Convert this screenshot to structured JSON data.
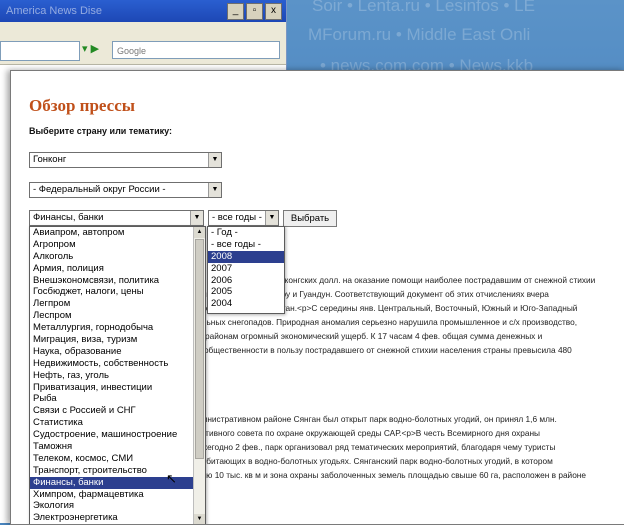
{
  "background": {
    "lines": [
      "Soir • Lenta.ru • Lesinfos • LE",
      "MForum.ru • Middle East Onli",
      "• news.com.com • News.kkb"
    ],
    "back_title": "America News Dise"
  },
  "back_window": {
    "controls": [
      "_",
      "▫",
      "x"
    ],
    "search_placeholder": "Google"
  },
  "page": {
    "title": "Обзор прессы",
    "prompt": "Выберите страну или тематику:",
    "country_select": "Гонконг",
    "district_select": "- Федеральный округ России -",
    "topic_select": "Финансы, банки",
    "year_select": "- все годы -",
    "submit_label": "Выбрать"
  },
  "topic_options": [
    "Авиапром, автопром",
    "Агропром",
    "Алкоголь",
    "Армия, полиция",
    "Внешэкономсвязи, политика",
    "Госбюджет, налоги, цены",
    "Легпром",
    "Леспром",
    "Металлургия, горнодобыча",
    "Миграция, виза, туризм",
    "Наука, образование",
    "Недвижимость, собственность",
    "Нефть, газ, уголь",
    "Приватизация, инвестиции",
    "Рыба",
    "Связи с Россией и СНГ",
    "Статистика",
    "Судостроение, машиностроение",
    "Таможня",
    "Телеком, космос, СМИ",
    "Транспорт, строительство",
    "Финансы, банки",
    "Химпром, фармацевтика",
    "Экология",
    "Электроэнергетика"
  ],
  "topic_selected": "Финансы, банки",
  "year_options": [
    "- Год -",
    "- все годы -",
    "2008",
    "2007",
    "2006",
    "2005",
    "2004"
  ],
  "year_selected": "2008",
  "article_lines": [
    "нгконгских долл. на оказание помощи наиболее пострадавшим от снежной стихии",
    "инции Хуэнань, Гуйчжоу и Гуандун. Соответствующий документ об этих отчислениях вчера",
    "ьного совета САР Сянган.<p>С середины янв. Центральный, Восточный, Южный и Юго-Западный",
    "ильных снегопадов. Природная аномалия серьезно нарушила промышленное и с/х производство,",
    "м районам огромный экономический ущерб. К 17 часам 4 фев. общая сумма денежных и",
    "й общественности в пользу пострадавшего от снежной стихии населения страны превысила 480",
    "министративном районе Сянган был открыт парк водно-болотных угодий, он принял 1,6 млн.",
    "тативного совета по охране окружающей среды САР.<p>В честь Всемирного дня охраны",
    "ежегодно 2 фев., парк организовал ряд тематических мероприятий, благодаря чему туристы",
    ", обитающих в водно-болотных угодьях. Сянганский парк водно-болотных угодий, в котором",
    "дью 10 тыс. кв м и зона охраны заболоченных земель площадью свыше 60 га, расположен в районе"
  ]
}
